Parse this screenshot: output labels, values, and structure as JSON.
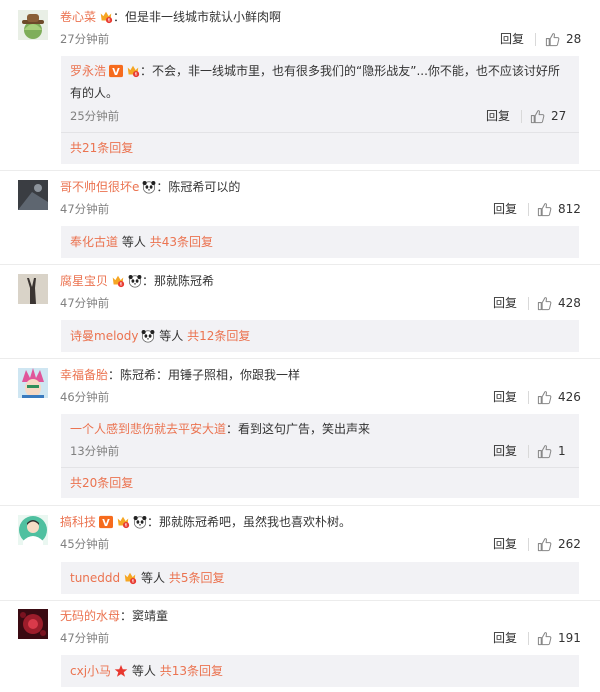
{
  "common": {
    "reply_label": "回复"
  },
  "comments": [
    {
      "author": "卷心菜",
      "text": "：但是非一线城市就认小鲜肉啊",
      "time": "27分钟前",
      "likes": "28",
      "replies": [
        {
          "author": "罗永浩",
          "text_line1": "：不会，非一线城市里，也有很多我们的“隐形战友”...你不能，也不应该讨好所",
          "text_line2": "有的人。",
          "time": "25分钟前",
          "likes": "27"
        }
      ],
      "more": "共21条回复"
    },
    {
      "author": "哥不帅但很坏e",
      "text": "：陈冠希可以的",
      "time": "47分钟前",
      "likes": "812",
      "more_user": "奉化古道",
      "more_mid": "等人",
      "more": "共43条回复"
    },
    {
      "author": "腐星宝贝",
      "text": "：那就陈冠希",
      "time": "47分钟前",
      "likes": "428",
      "more_user": "诗曼melody",
      "more_mid": "等人",
      "more": "共12条回复"
    },
    {
      "author": "幸福备胎",
      "text": "：陈冠希：用锤子照相，你跟我一样",
      "time": "46分钟前",
      "likes": "426",
      "replies": [
        {
          "author": "一个人感到悲伤就去平安大道",
          "text_line1": "：看到这句广告，笑出声来",
          "time": "13分钟前",
          "likes": "1"
        }
      ],
      "more": "共20条回复"
    },
    {
      "author": "搞科技",
      "text": "：那就陈冠希吧，虽然我也喜欢朴树。",
      "time": "45分钟前",
      "likes": "262",
      "more_user": "tuneddd",
      "more_mid": "等人",
      "more": "共5条回复"
    },
    {
      "author": "无码的水母",
      "text": "：窦靖童",
      "time": "47分钟前",
      "likes": "191",
      "more_user": "cxj小马",
      "more_mid": "等人",
      "more": "共13条回复"
    }
  ],
  "colors": {
    "accent": "#eb7350",
    "reply_bg": "#f2f2f5",
    "text": "#333333",
    "muted": "#808080"
  }
}
